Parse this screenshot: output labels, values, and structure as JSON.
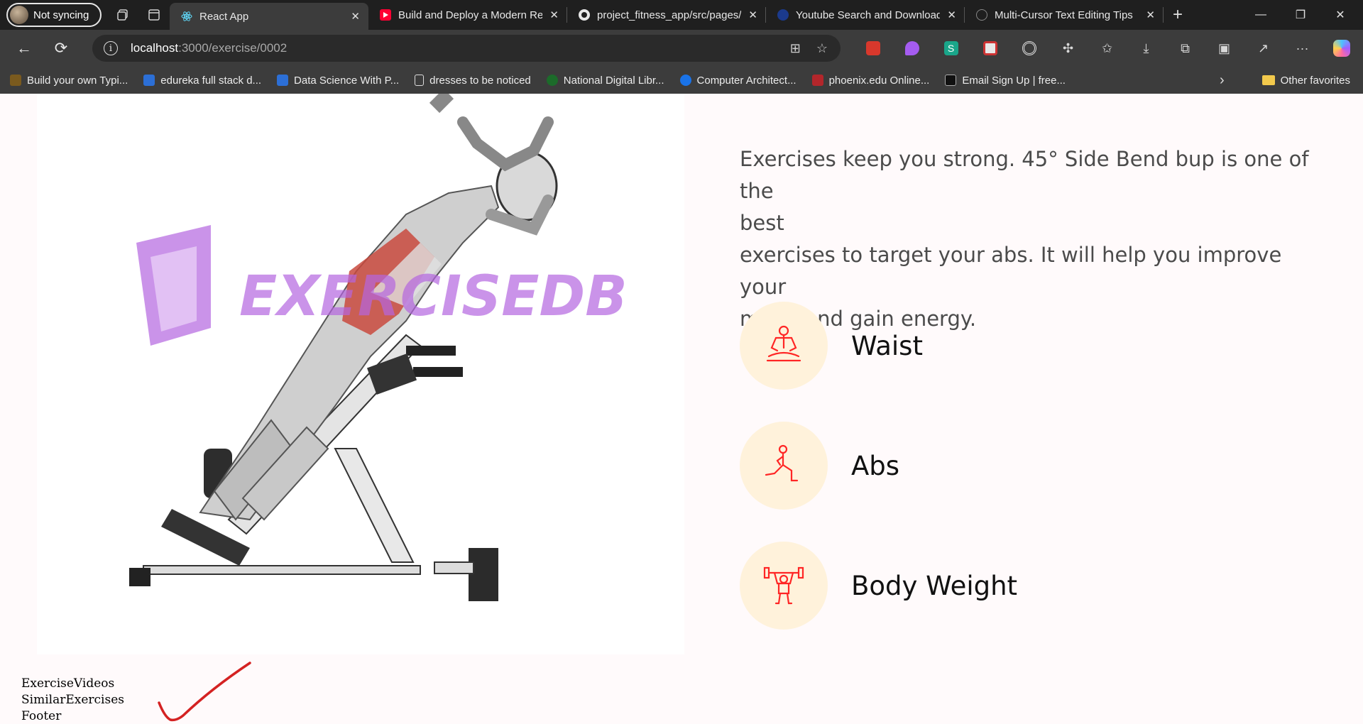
{
  "browser": {
    "profile_label": "Not syncing",
    "tabs": [
      {
        "title": "React App",
        "active": true,
        "favicon": "react-icon"
      },
      {
        "title": "Build and Deploy a Modern Re",
        "active": false,
        "favicon": "youtube-icon"
      },
      {
        "title": "project_fitness_app/src/pages/",
        "active": false,
        "favicon": "github-icon"
      },
      {
        "title": "Youtube Search and Download",
        "active": false,
        "favicon": "rapidapi-icon"
      },
      {
        "title": "Multi-Cursor Text Editing Tips",
        "active": false,
        "favicon": "chatgpt-icon"
      }
    ],
    "url": {
      "host": "localhost",
      "path": ":3000/exercise/0002"
    },
    "bookmarks": [
      {
        "label": "Build your own Typi...",
        "color": "#7a5a1e"
      },
      {
        "label": "edureka full stack d...",
        "color": "#2c6fd6"
      },
      {
        "label": "Data Science With P...",
        "color": "#2c6fd6"
      },
      {
        "label": "dresses to be noticed",
        "color": "#3c3c3c"
      },
      {
        "label": "National Digital Libr...",
        "color": "#1c6b2a"
      },
      {
        "label": "Computer Architect...",
        "color": "#1a73e8"
      },
      {
        "label": "phoenix.edu Online...",
        "color": "#b3262b"
      },
      {
        "label": "Email Sign Up | free...",
        "color": "#111111"
      }
    ],
    "other_favorites": "Other favorites"
  },
  "page": {
    "watermark": "EXERCISEDB",
    "description_lines": [
      "Exercises keep you strong. 45° Side Bend bup is one of the",
      "best",
      "exercises to target your abs. It will help you improve your",
      "mood and gain energy."
    ],
    "details": [
      {
        "name": "Waist",
        "icon": "meditation-icon"
      },
      {
        "name": "Abs",
        "icon": "lunge-icon"
      },
      {
        "name": "Body Weight",
        "icon": "weightlifter-icon"
      }
    ],
    "placeholders": [
      "ExerciseVideos",
      "SimilarExercises",
      "Footer"
    ]
  },
  "colors": {
    "accent_red": "#ff2625",
    "detail_bg": "#fff2db",
    "watermark_purple": "#b566e0"
  }
}
